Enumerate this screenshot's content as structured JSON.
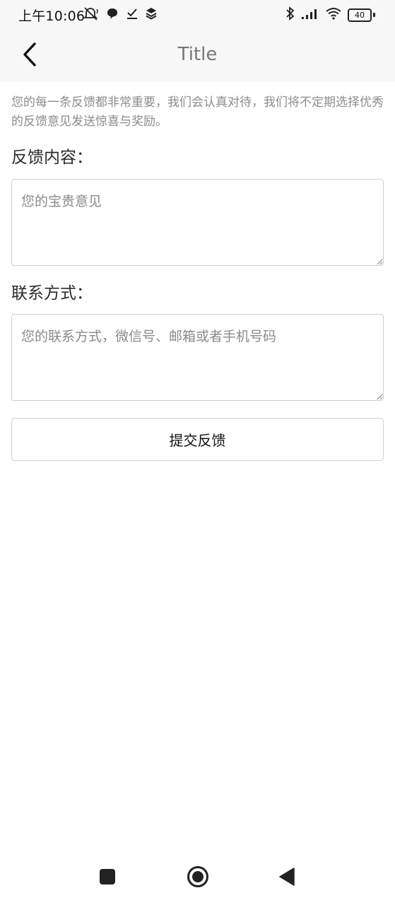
{
  "status_bar": {
    "time": "上午10:06",
    "battery_level": "40",
    "left_icons": [
      "mute-alarm-icon",
      "chat-bubble-icon",
      "check-download-icon",
      "layers-icon"
    ],
    "right_icons": [
      "bluetooth-icon",
      "signal-icon",
      "wifi-icon",
      "battery-icon"
    ]
  },
  "app_bar": {
    "title": "Title",
    "back_icon": "chevron-left-icon"
  },
  "form": {
    "intro": "您的每一条反馈都非常重要，我们会认真对待，我们将不定期选择优秀的反馈意见发送惊喜与奖励。",
    "feedback_label": "反馈内容：",
    "feedback_placeholder": "您的宝贵意见",
    "feedback_value": "",
    "contact_label": "联系方式：",
    "contact_placeholder": "您的联系方式，微信号、邮箱或者手机号码",
    "contact_value": "",
    "submit_label": "提交反馈"
  },
  "nav_bar": {
    "icons": [
      "recent-apps-square-icon",
      "home-circle-icon",
      "back-triangle-icon"
    ]
  },
  "colors": {
    "bar_background": "#f7f7f7",
    "title_text": "#777777",
    "hint_text": "#8c8c8c",
    "border": "#cfcfcf"
  }
}
